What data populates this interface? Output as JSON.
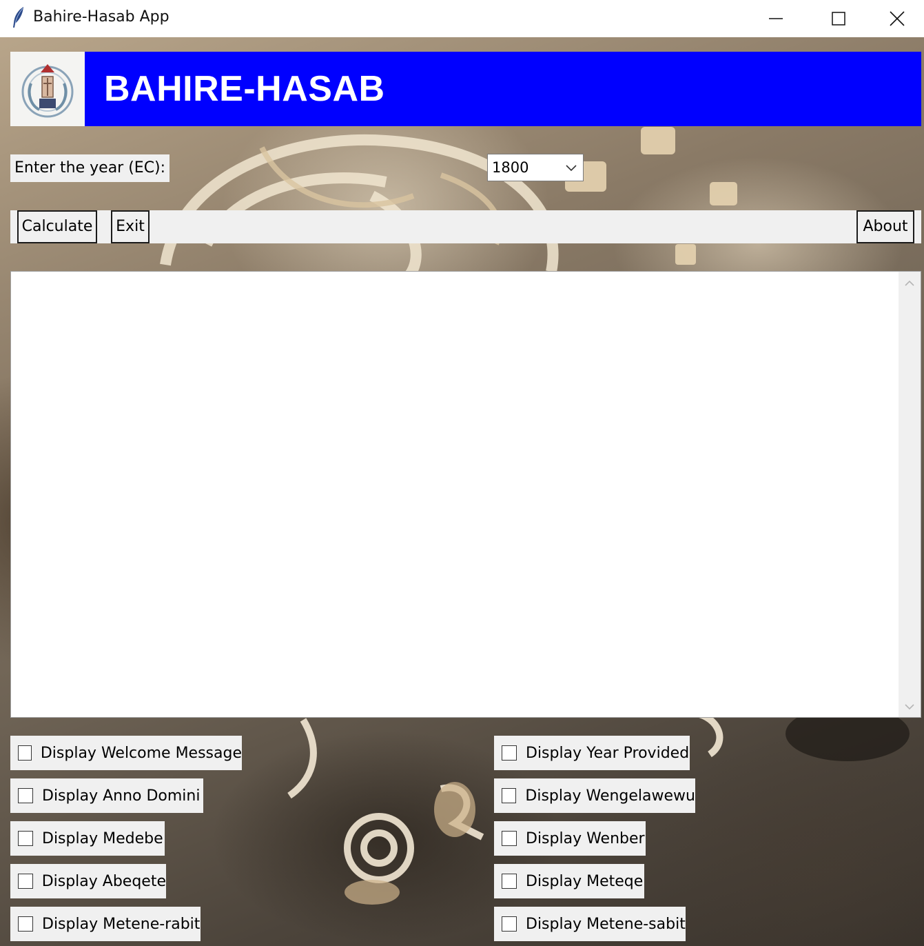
{
  "window": {
    "title": "Bahire-Hasab App",
    "controls": [
      "minimize",
      "maximize",
      "close"
    ]
  },
  "header": {
    "brand": "BAHIRE-HASAB",
    "logo_icon": "emblem-icon",
    "banner_color": "#0000ff"
  },
  "year": {
    "label": "Enter the year (EC):",
    "selected": "1800"
  },
  "toolbar": {
    "calculate_label": "Calculate",
    "exit_label": "Exit",
    "about_label": "About"
  },
  "output": {
    "text": ""
  },
  "checkboxes": {
    "left": [
      {
        "label": "Display Welcome Message",
        "checked": false
      },
      {
        "label": "Display Anno Domini",
        "checked": false
      },
      {
        "label": "Display Medebe",
        "checked": false
      },
      {
        "label": "Display Abeqete",
        "checked": false
      },
      {
        "label": "Display Metene-rabit",
        "checked": false
      }
    ],
    "right": [
      {
        "label": "Display Year Provided",
        "checked": false
      },
      {
        "label": "Display Wengelawewu",
        "checked": false
      },
      {
        "label": "Display Wenber",
        "checked": false
      },
      {
        "label": "Display Meteqe",
        "checked": false
      },
      {
        "label": "Display Metene-sabit",
        "checked": false
      }
    ]
  }
}
